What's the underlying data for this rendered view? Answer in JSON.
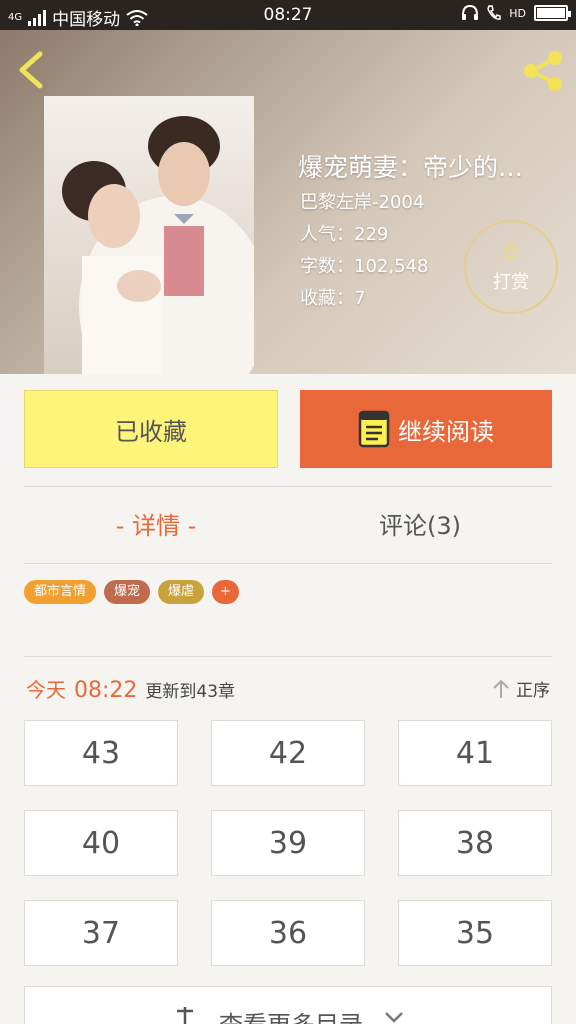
{
  "status_bar": {
    "carrier": "中国移动",
    "network": "4G",
    "time": "08:27",
    "hd_label": "HD"
  },
  "book": {
    "title": "爆宠萌妻：帝少的…",
    "author": "巴黎左岸-2004",
    "popularity": "人气：229",
    "word_count": "字数：102,548",
    "favorites": "收藏：7"
  },
  "tip": {
    "count": "0",
    "label": "打赏"
  },
  "actions": {
    "collected_label": "已收藏",
    "continue_label": "继续阅读"
  },
  "tabs": {
    "detail_label": "- 详情 -",
    "comments_label": "评论(3)"
  },
  "tags": [
    {
      "label": "都市言情",
      "color": "#f0a030"
    },
    {
      "label": "爆宠",
      "color": "#c06a4e"
    },
    {
      "label": "爆虐",
      "color": "#c9a23e"
    },
    {
      "label": "+",
      "color": "#e8683a"
    }
  ],
  "update": {
    "today": "今天",
    "time": "08:22",
    "text": "更新到43章",
    "sort_label": "正序"
  },
  "chapters": [
    "43",
    "42",
    "41",
    "40",
    "39",
    "38",
    "37",
    "36",
    "35"
  ],
  "more": {
    "label": "查看更多目录"
  },
  "colors": {
    "accent": "#e8683a",
    "collected_bg": "#fff47a",
    "tip_ring": "#e4cf8a"
  }
}
